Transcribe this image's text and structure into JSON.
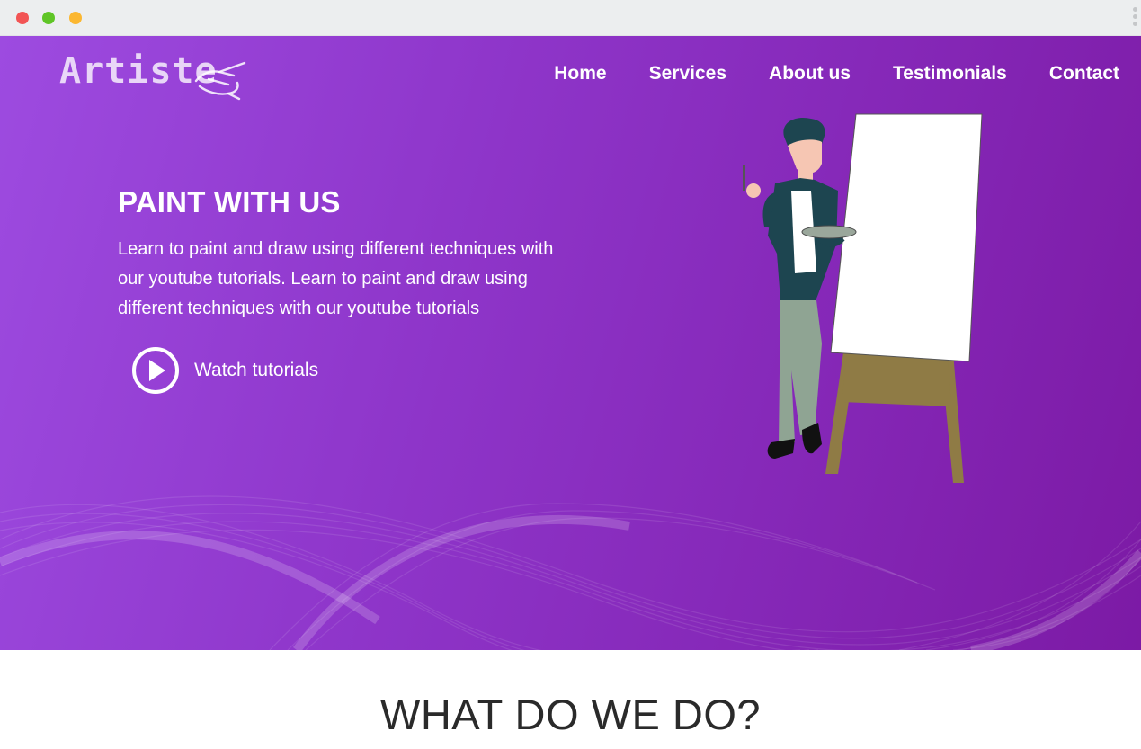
{
  "brand": {
    "logo_text": "Artiste",
    "logo_icon": "hand-drawing-icon"
  },
  "nav": {
    "items": [
      {
        "label": "Home"
      },
      {
        "label": "Services"
      },
      {
        "label": "About us"
      },
      {
        "label": "Testimonials"
      },
      {
        "label": "Contact"
      }
    ]
  },
  "hero": {
    "title": "PAINT WITH US",
    "description": "Learn to paint and draw using different techniques with our youtube tutorials. Learn to paint and draw using different techniques with our youtube tutorials",
    "cta_label": "Watch tutorials",
    "cta_icon": "play-circle-icon",
    "illustration": "painter-with-easel-illustration"
  },
  "section": {
    "title": "WHAT DO WE DO?"
  },
  "colors": {
    "hero_start": "#9d4be0",
    "hero_end": "#7c1aa5",
    "text_light": "#ffffff",
    "heading_dark": "#2a2a2a"
  }
}
